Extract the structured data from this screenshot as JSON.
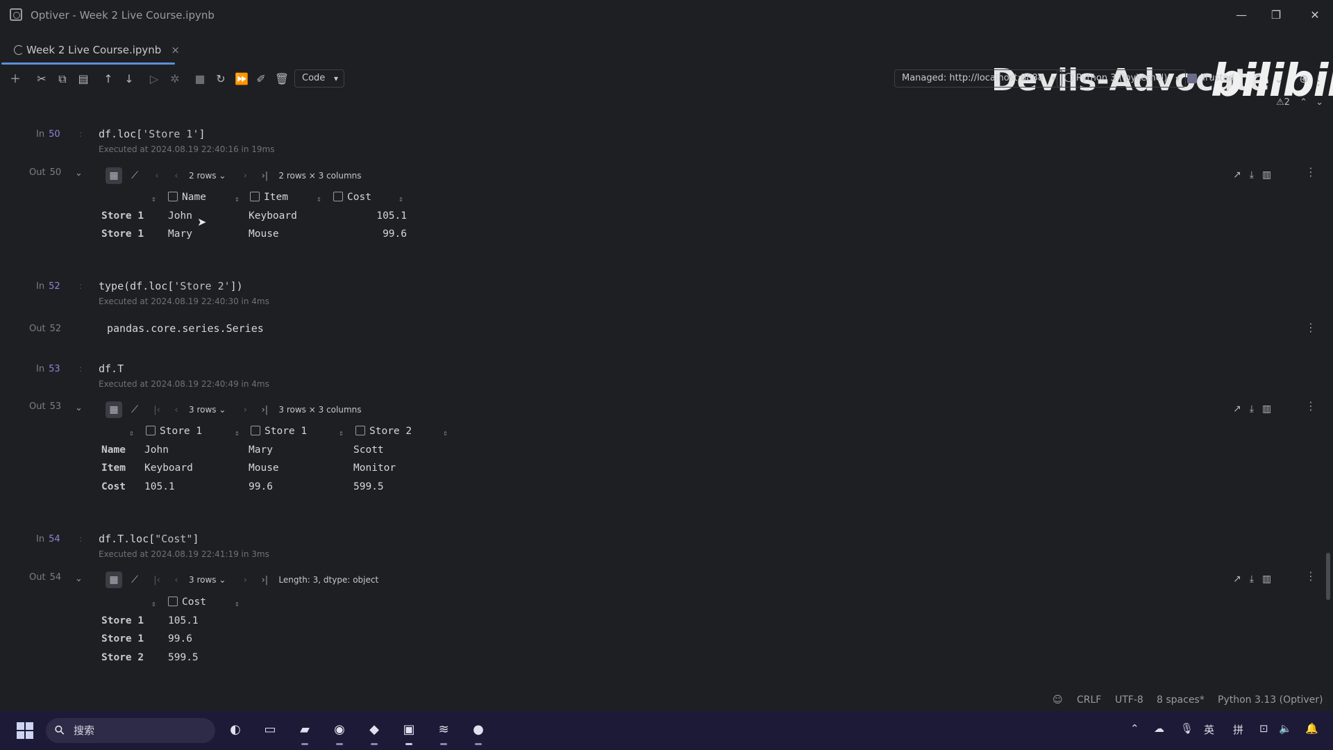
{
  "window": {
    "title": "Optiver - Week 2 Live Course.ipynb"
  },
  "tab": {
    "label": "Week 2 Live Course.ipynb",
    "close": "×"
  },
  "watermark": {
    "text": "Devils-Advocate",
    "logo": "bilibili"
  },
  "toolbar": {
    "cell_type": "Code",
    "server": "Managed: http://localhost:8888",
    "kernel": "Python 3 (ipykernel)",
    "trusted": "Trusted",
    "warnings": "2"
  },
  "cells": {
    "c50": {
      "in_label": "In",
      "in_num": "50",
      "code_prefix": "df.loc[",
      "code_str": "'Store 1'",
      "code_suffix": "]",
      "exec": "Executed at 2024.08.19 22:40:16 in 19ms",
      "out_label": "Out",
      "out_num": "50",
      "rows_dd": "2 rows",
      "shape": "2 rows × 3 columns",
      "headers": [
        "Name",
        "Item",
        "Cost"
      ],
      "rows": [
        {
          "idx": "Store 1",
          "c1": "John",
          "c2": "Keyboard",
          "c3": "105.1"
        },
        {
          "idx": "Store 1",
          "c1": "Mary",
          "c2": "Mouse",
          "c3": "99.6"
        }
      ]
    },
    "c52": {
      "in_label": "In",
      "in_num": "52",
      "code_prefix": "type(df.loc[",
      "code_str": "'Store 2'",
      "code_suffix": "])",
      "exec": "Executed at 2024.08.19 22:40:30 in 4ms",
      "out_label": "Out",
      "out_num": "52",
      "output": "pandas.core.series.Series"
    },
    "c53": {
      "in_label": "In",
      "in_num": "53",
      "code": "df.T",
      "exec": "Executed at 2024.08.19 22:40:49 in 4ms",
      "out_label": "Out",
      "out_num": "53",
      "rows_dd": "3 rows",
      "shape": "3 rows × 3 columns",
      "headers": [
        "Store 1",
        "Store 1",
        "Store 2"
      ],
      "rows": [
        {
          "idx": "Name",
          "c1": "John",
          "c2": "Mary",
          "c3": "Scott"
        },
        {
          "idx": "Item",
          "c1": "Keyboard",
          "c2": "Mouse",
          "c3": "Monitor"
        },
        {
          "idx": "Cost",
          "c1": "105.1",
          "c2": "99.6",
          "c3": "599.5"
        }
      ]
    },
    "c54": {
      "in_label": "In",
      "in_num": "54",
      "code_prefix": "df.T.loc[",
      "code_str": "\"Cost\"",
      "code_suffix": "]",
      "exec": "Executed at 2024.08.19 22:41:19 in 3ms",
      "out_label": "Out",
      "out_num": "54",
      "rows_dd": "3 rows",
      "shape": "Length: 3, dtype: object",
      "headers": [
        "Cost"
      ],
      "rows": [
        {
          "idx": "Store 1",
          "c1": "105.1"
        },
        {
          "idx": "Store 1",
          "c1": "99.6"
        },
        {
          "idx": "Store 2",
          "c1": "599.5"
        }
      ]
    }
  },
  "statusbar": {
    "line_sep": "CRLF",
    "encoding": "UTF-8",
    "indent": "8 spaces*",
    "interpreter": "Python 3.13 (Optiver)"
  },
  "taskbar": {
    "search_placeholder": "搜索",
    "ime_lang": "英",
    "ime_mode": "拼"
  }
}
